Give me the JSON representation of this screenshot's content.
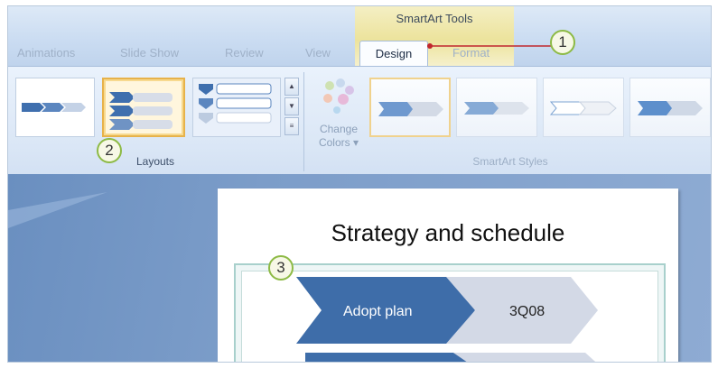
{
  "ribbon": {
    "context_title": "SmartArt Tools",
    "tabs": [
      "Animations",
      "Slide Show",
      "Review",
      "View",
      "Design",
      "Format"
    ],
    "active_tab": "Design",
    "groups": {
      "layouts_label": "Layouts",
      "change_colors_label": "Change Colors",
      "change_colors_line1": "Change",
      "change_colors_line2": "Colors ▾",
      "smartart_styles_label": "SmartArt Styles"
    }
  },
  "slide": {
    "title": "Strategy and schedule",
    "smartart": {
      "rows": [
        {
          "primary": "Adopt plan",
          "secondary": "3Q08"
        }
      ]
    }
  },
  "callouts": [
    "1",
    "2",
    "3"
  ],
  "colors": {
    "accent_blue": "#4f81bd",
    "light_chevron": "#d3d9e6",
    "context_yellow": "#ece39c",
    "selection_orange": "#e7b24a",
    "callout_green": "#8dba45",
    "callout_leader_red": "#c0272d"
  }
}
